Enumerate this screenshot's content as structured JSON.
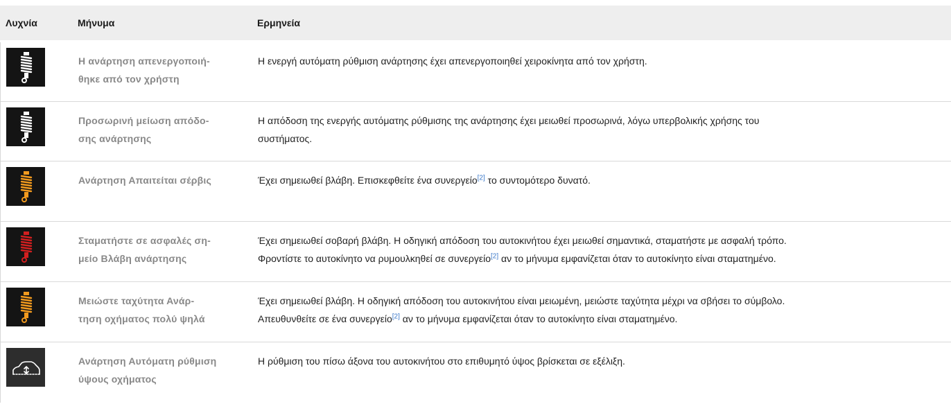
{
  "header": {
    "col_lamp": "Λυχνία",
    "col_message": "Μήνυμα",
    "col_interpretation": "Ερμηνεία"
  },
  "colors": {
    "white": "#ffffff",
    "amber": "#f29a1e",
    "red": "#d21f1f",
    "header_bg": "#eeeeee",
    "ref_link": "#3a78c9"
  },
  "rows": [
    {
      "icon": "suspension-white-icon",
      "message": "Η ανάρτηση απενεργοποιή-θηκε από τον χρήστη",
      "message_l1": "Η ανάρτηση απενεργοποιή-",
      "message_l2": "θηκε από τον χρήστη",
      "interp_l1": "Η ενεργή αυτόματη ρύθμιση ανάρτησης έχει απενεργοποιηθεί χειροκίνητα από τον χρήστη."
    },
    {
      "icon": "suspension-white-icon",
      "message_l1": "Προσωρινή μείωση απόδο-",
      "message_l2": "σης ανάρτησης",
      "interp_l1": "Η απόδοση της ενεργής αυτόματης ρύθμισης της ανάρτησης έχει μειωθεί προσωρινά, λόγω υπερβολικής χρήσης του",
      "interp_l2": "συστήματος."
    },
    {
      "icon": "suspension-amber-icon",
      "message_l1": "Ανάρτηση Απαιτείται σέρβις",
      "interp_a": "Έχει σημειωθεί βλάβη. Επισκεφθείτε ένα συνεργείο",
      "ref": "[2]",
      "interp_b": " το συντομότερο δυνατό."
    },
    {
      "icon": "suspension-red-icon",
      "message_l1": "Σταματήστε σε ασφαλές ση-",
      "message_l2": "μείο Βλάβη ανάρτησης",
      "interp_l1": "Έχει σημειωθεί σοβαρή βλάβη. Η οδηγική απόδοση του αυτοκινήτου έχει μειωθεί σημαντικά, σταματήστε με ασφαλή τρόπο.",
      "interp_a": "Φροντίστε το αυτοκίνητο να ρυμουλκηθεί σε συνεργείο",
      "ref": "[2]",
      "interp_b": " αν το μήνυμα εμφανίζεται όταν το αυτοκίνητο είναι σταματημένο."
    },
    {
      "icon": "suspension-amber-icon",
      "message_l1": "Μειώστε ταχύτητα Ανάρ-",
      "message_l2": "τηση οχήματος πολύ ψηλά",
      "interp_l1": "Έχει σημειωθεί βλάβη. Η οδηγική απόδοση του αυτοκινήτου είναι μειωμένη, μειώστε ταχύτητα μέχρι να σβήσει το σύμβολο.",
      "interp_a": "Απευθυνθείτε σε ένα συνεργείο",
      "ref": "[2]",
      "interp_b": " αν το μήνυμα εμφανίζεται όταν το αυτοκίνητο είναι σταματημένο."
    },
    {
      "icon": "vehicle-height-icon",
      "message_l1": "Ανάρτηση Αυτόματη ρύθμιση",
      "message_l2": "ύψους οχήματος",
      "interp_l1": "Η ρύθμιση του πίσω άξονα του αυτοκινήτου στο επιθυμητό ύψος βρίσκεται σε εξέλιξη."
    }
  ]
}
